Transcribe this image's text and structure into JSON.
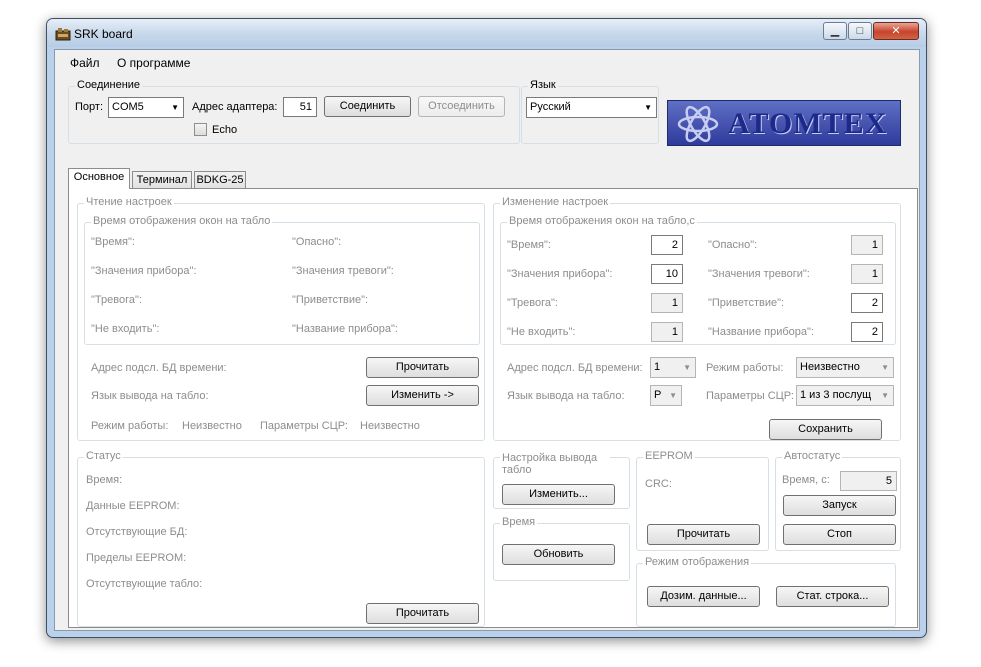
{
  "window": {
    "title": "SRK board",
    "minimize": "▁",
    "maximize": "□",
    "close": "✕"
  },
  "menu": {
    "file": "Файл",
    "about": "О программе"
  },
  "connection": {
    "title": "Соединение",
    "port_label": "Порт:",
    "port_value": "COM5",
    "adapter_label": "Адрес адаптера:",
    "adapter_value": "51",
    "connect": "Соединить",
    "disconnect": "Отсоединить",
    "echo": "Echo"
  },
  "language": {
    "title": "Язык",
    "value": "Русский"
  },
  "logo": {
    "text": "ATOMTEX"
  },
  "tabs": [
    "Основное",
    "Терминал",
    "BDKG-25"
  ],
  "read_settings": {
    "title": "Чтение настроек",
    "display_time_title": "Время отображения окон на табло",
    "fields": [
      "\"Время\":",
      "\"Опасно\":",
      "\"Значения прибора\":",
      "\"Значения тревоги\":",
      "\"Тревога\":",
      "\"Приветствие\":",
      "\"Не входить\":",
      "\"Название прибора\":"
    ],
    "db_address_label": "Адрес подсл. БД времени:",
    "read_button": "Прочитать",
    "language_label": "Язык вывода на табло:",
    "change_button": "Изменить ->",
    "mode_label": "Режим работы:",
    "mode_value": "Неизвестно",
    "params_label": "Параметры СЦР:",
    "params_value": "Неизвестно"
  },
  "change_settings": {
    "title": "Изменение настроек",
    "display_time_title": "Время отображения окон на табло,с",
    "fields": [
      {
        "label": "\"Время\":",
        "value": "2"
      },
      {
        "label": "\"Опасно\":",
        "value": "1"
      },
      {
        "label": "\"Значения прибора\":",
        "value": "10"
      },
      {
        "label": "\"Значения тревоги\":",
        "value": "1"
      },
      {
        "label": "\"Тревога\":",
        "value": "1"
      },
      {
        "label": "\"Приветствие\":",
        "value": "2"
      },
      {
        "label": "\"Не входить\":",
        "value": "1"
      },
      {
        "label": "\"Название прибора\":",
        "value": "2"
      }
    ],
    "db_address_label": "Адрес подсл. БД времени:",
    "db_address_value": "1",
    "mode_label": "Режим работы:",
    "mode_value": "Неизвестно",
    "language_label": "Язык вывода на табло:",
    "language_value": "Р",
    "params_label": "Параметры СЦР:",
    "params_value": "1 из 3 послущ",
    "save_button": "Сохранить"
  },
  "status": {
    "title": "Статус",
    "rows": [
      "Время:",
      "Данные EEPROM:",
      "Отсутствующие БД:",
      "Пределы EEPROM:",
      "Отсутствующие табло:"
    ],
    "read_button": "Прочитать"
  },
  "display_output": {
    "title": "Настройка вывода табло",
    "change_button": "Изменить..."
  },
  "time_box": {
    "title": "Время",
    "refresh_button": "Обновить"
  },
  "eeprom": {
    "title": "EEPROM",
    "crc_label": "CRC:",
    "read_button": "Прочитать"
  },
  "autostatus": {
    "title": "Автостатус",
    "time_label": "Время, с:",
    "time_value": "5",
    "start_button": "Запуск",
    "stop_button": "Стоп"
  },
  "display_mode": {
    "title": "Режим отображения",
    "dose_button": "Дозим. данные...",
    "stat_button": "Стат. строка..."
  }
}
